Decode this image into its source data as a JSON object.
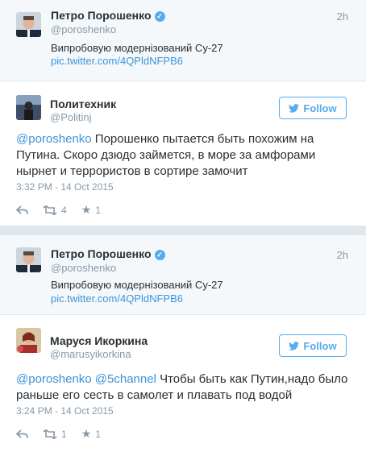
{
  "tweets": [
    {
      "quoted": {
        "name": "Петро Порошенко",
        "handle": "@poroshenko",
        "time": "2h",
        "text": "Випробовую модернізований Су-27",
        "link": "pic.twitter.com/4QPldNFPB6"
      },
      "author": {
        "name": "Политехник",
        "handle": "@Politinj"
      },
      "follow_label": "Follow",
      "mentions": [
        "@poroshenko"
      ],
      "text": "Порошенко пытается быть похожим на Путина. Скоро дзюдо займется, в море за амфорами нырнет и террористов в сортире замочит",
      "timestamp": "3:32 PM - 14 Oct 2015",
      "retweets": "4",
      "favorites": "1"
    },
    {
      "quoted": {
        "name": "Петро Порошенко",
        "handle": "@poroshenko",
        "time": "2h",
        "text": "Випробовую модернізований Су-27",
        "link": "pic.twitter.com/4QPldNFPB6"
      },
      "author": {
        "name": "Маруся Икоркина",
        "handle": "@marusyikorkina"
      },
      "follow_label": "Follow",
      "mentions": [
        "@poroshenko",
        "@5channel"
      ],
      "text": "Чтобы быть как Путин,надо было раньше его сесть в самолет и плавать под водой",
      "timestamp": "3:24 PM - 14 Oct 2015",
      "retweets": "1",
      "favorites": "1"
    }
  ],
  "colors": {
    "link": "#3b94d9",
    "follow": "#55acee",
    "muted": "#8899a6",
    "separator": "#e1e8ed"
  }
}
